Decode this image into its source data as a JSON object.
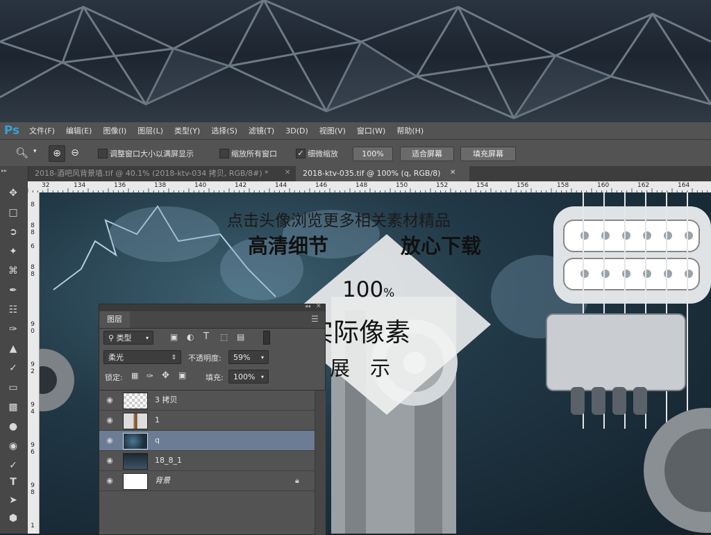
{
  "app": {
    "logo": "Ps"
  },
  "menu": [
    "文件(F)",
    "编辑(E)",
    "图像(I)",
    "图层(L)",
    "类型(Y)",
    "选择(S)",
    "滤镜(T)",
    "3D(D)",
    "视图(V)",
    "窗口(W)",
    "帮助(H)"
  ],
  "options": {
    "tool_icon": "zoom-icon",
    "resize_windows_label": "调整窗口大小以满屏显示",
    "resize_windows_checked": false,
    "zoom_all_label": "缩放所有窗口",
    "zoom_all_checked": false,
    "scrubby_zoom_label": "细微缩放",
    "scrubby_zoom_checked": true,
    "btn_100": "100%",
    "btn_fit": "适合屏幕",
    "btn_fill": "填充屏幕"
  },
  "tabs": [
    {
      "label": "2018-酒吧风背景墙.tif @ 40.1% (2018-ktv-034 拷贝, RGB/8#) *",
      "active": false
    },
    {
      "label": "2018-ktv-035.tif @ 100% (q, RGB/8)",
      "active": true
    }
  ],
  "ruler_h": [
    "32",
    "134",
    "136",
    "138",
    "140",
    "142",
    "144",
    "146",
    "148",
    "150",
    "152",
    "154",
    "156",
    "158",
    "160",
    "162",
    "164"
  ],
  "ruler_v": [
    "8",
    "8",
    "8",
    "6",
    "8",
    "8",
    "9",
    "0",
    "9",
    "2",
    "9",
    "4",
    "9",
    "6",
    "9",
    "8",
    "1"
  ],
  "layers_panel": {
    "title": "图层",
    "filter_label": "类型",
    "blend_mode": "柔光",
    "opacity_label": "不透明度:",
    "opacity_value": "59%",
    "lock_label": "锁定:",
    "fill_label": "填充:",
    "fill_value": "100%",
    "layers": [
      {
        "name": "3 拷贝",
        "selected": false,
        "locked": false
      },
      {
        "name": "1",
        "selected": false,
        "locked": false
      },
      {
        "name": "q",
        "selected": true,
        "locked": false
      },
      {
        "name": "18_8_1",
        "selected": false,
        "locked": false
      },
      {
        "name": "背景",
        "selected": false,
        "locked": true
      }
    ]
  },
  "promo": {
    "line1": "点击头像浏览更多相关素材精品",
    "line2a": "高清细节",
    "line2b": "放心下载",
    "zoom": "100",
    "zoom_unit": "%",
    "title": "实际像素",
    "subtitle": "展　示"
  },
  "colors": {
    "accent_ps": "#35a1d7",
    "selected_layer": "#6c7c94"
  }
}
